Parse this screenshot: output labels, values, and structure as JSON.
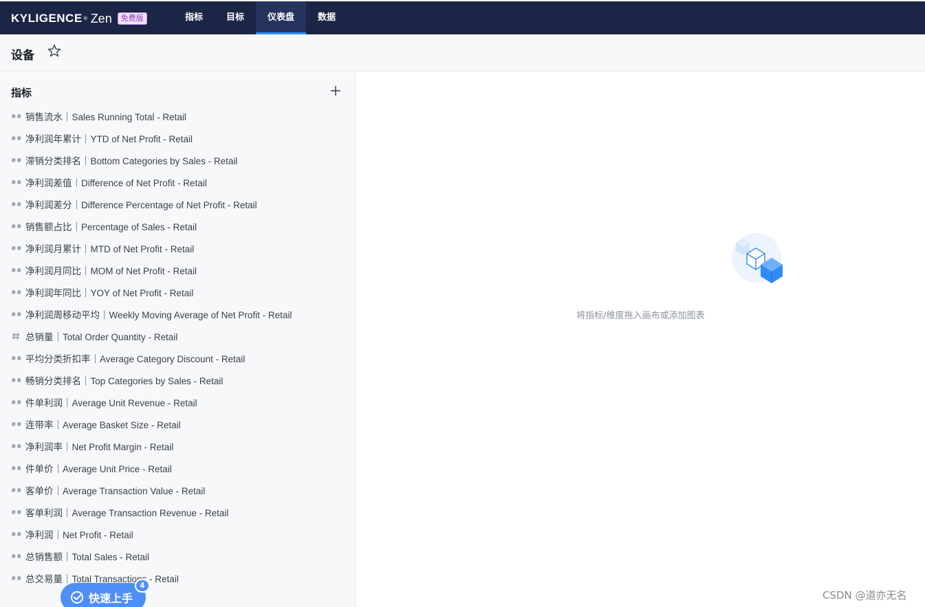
{
  "app": {
    "brand_name": "KYLIGENCE",
    "brand_mark": "®",
    "brand_product": "Zen",
    "brand_badge": "免费版"
  },
  "nav": {
    "items": [
      {
        "label": "指标",
        "active": false
      },
      {
        "label": "目标",
        "active": false
      },
      {
        "label": "仪表盘",
        "active": true
      },
      {
        "label": "数据",
        "active": false
      }
    ]
  },
  "page": {
    "title": "设备",
    "favorite_icon": "star-outline-icon"
  },
  "sidebar": {
    "title": "指标",
    "add_icon": "plus-icon",
    "items": [
      {
        "label": "销售流水｜Sales Running Total - Retail",
        "icon": "derived-metric-icon"
      },
      {
        "label": "净利润年累计｜YTD of Net Profit - Retail",
        "icon": "derived-metric-icon"
      },
      {
        "label": "滞销分类排名｜Bottom Categories by Sales - Retail",
        "icon": "derived-metric-icon"
      },
      {
        "label": "净利润差值｜Difference of Net Profit - Retail",
        "icon": "derived-metric-icon"
      },
      {
        "label": "净利润差分｜Difference Percentage of Net Profit - Retail",
        "icon": "derived-metric-icon"
      },
      {
        "label": "销售额占比｜Percentage of Sales - Retail",
        "icon": "derived-metric-icon"
      },
      {
        "label": "净利润月累计｜MTD of Net Profit - Retail",
        "icon": "derived-metric-icon"
      },
      {
        "label": "净利润月同比｜MOM of Net Profit - Retail",
        "icon": "derived-metric-icon"
      },
      {
        "label": "净利润年同比｜YOY of Net Profit - Retail",
        "icon": "derived-metric-icon"
      },
      {
        "label": "净利润周移动平均｜Weekly Moving Average of Net Profit - Retail",
        "icon": "derived-metric-icon"
      },
      {
        "label": "总销量｜Total Order Quantity - Retail",
        "icon": "atomic-metric-icon"
      },
      {
        "label": "平均分类折扣率｜Average Category Discount - Retail",
        "icon": "derived-metric-icon"
      },
      {
        "label": "畅销分类排名｜Top Categories by Sales - Retail",
        "icon": "derived-metric-icon"
      },
      {
        "label": "件单利润｜Average Unit Revenue - Retail",
        "icon": "derived-metric-icon"
      },
      {
        "label": "连带率｜Average Basket Size - Retail",
        "icon": "derived-metric-icon"
      },
      {
        "label": "净利润率｜Net Profit Margin - Retail",
        "icon": "derived-metric-icon"
      },
      {
        "label": "件单价｜Average Unit Price - Retail",
        "icon": "derived-metric-icon"
      },
      {
        "label": "客单价｜Average Transaction Value - Retail",
        "icon": "derived-metric-icon"
      },
      {
        "label": "客单利润｜Average Transaction Revenue - Retail",
        "icon": "derived-metric-icon"
      },
      {
        "label": "净利润｜Net Profit - Retail",
        "icon": "derived-metric-icon"
      },
      {
        "label": "总销售额｜Total Sales - Retail",
        "icon": "derived-metric-icon"
      },
      {
        "label": "总交易量｜Total Transactions - Retail",
        "icon": "derived-metric-icon"
      }
    ]
  },
  "canvas": {
    "empty_illustration": "cubes-illustration",
    "empty_text": "将指标/维度拖入画布或添加图表"
  },
  "quick_start": {
    "label": "快速上手",
    "count": "4",
    "icon": "check-circle-icon"
  },
  "watermark": "CSDN @道亦无名",
  "colors": {
    "nav_bg": "#1b2545",
    "nav_active_underline": "#2f8cf7",
    "panel_bg": "#f7f8fa",
    "quick_start_bg": "#4e8ef7",
    "illustration_blue": "#2f8cf7"
  }
}
